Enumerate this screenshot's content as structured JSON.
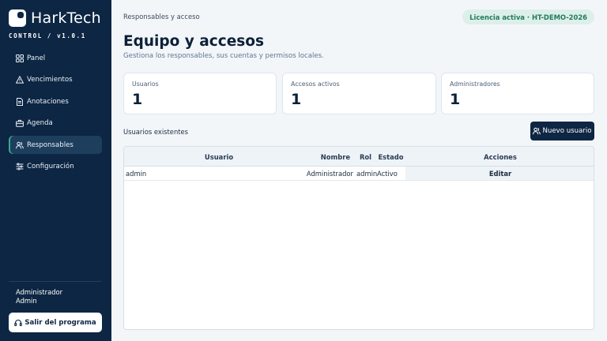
{
  "brand": {
    "name": "HarkTech",
    "subtitle": "CONTROL / v1.0.1"
  },
  "sidebar": {
    "items": [
      {
        "label": "Panel",
        "icon": "grid-icon"
      },
      {
        "label": "Vencimientos",
        "icon": "warning-icon"
      },
      {
        "label": "Anotaciones",
        "icon": "document-icon"
      },
      {
        "label": "Agenda",
        "icon": "briefcase-icon"
      },
      {
        "label": "Responsables",
        "icon": "users-icon",
        "active": true
      },
      {
        "label": "Configuración",
        "icon": "sliders-icon"
      }
    ],
    "user": {
      "name": "Administrador",
      "role": "Admin"
    },
    "logout_label": "Salir del programa"
  },
  "header": {
    "breadcrumb": "Responsables y acceso",
    "license": "Licencia activa · HT-DEMO-2026"
  },
  "page": {
    "title": "Equipo y accesos",
    "subtitle": "Gestiona los responsables, sus cuentas y permisos locales."
  },
  "stats": [
    {
      "label": "Usuarios",
      "value": "1"
    },
    {
      "label": "Accesos activos",
      "value": "1"
    },
    {
      "label": "Administradores",
      "value": "1"
    }
  ],
  "users_section": {
    "label": "Usuarios existentes",
    "new_button": "Nuevo usuario"
  },
  "table": {
    "headers": [
      "Usuario",
      "Nombre",
      "Rol",
      "Estado",
      "Acciones"
    ],
    "rows": [
      {
        "usuario": "admin",
        "nombre": "Administrador",
        "rol": "admin",
        "estado": "Activo",
        "accion": "Editar"
      }
    ]
  },
  "colors": {
    "sidebar": "#0d2643",
    "accent": "#39a88e",
    "license_bg": "#dcefe9",
    "license_text": "#24795f"
  }
}
